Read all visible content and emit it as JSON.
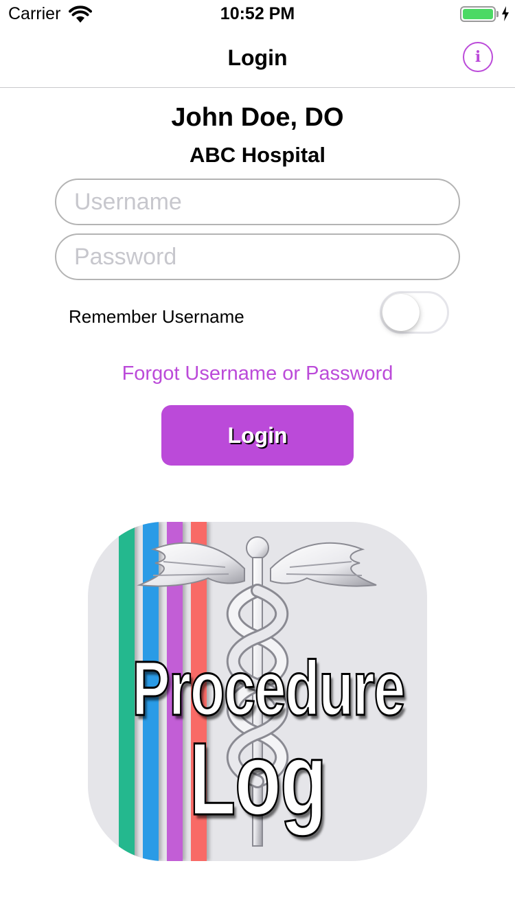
{
  "theme": {
    "accent": "#bb4ad9",
    "toggle_off_border": "#e5e5ea",
    "battery": "#4cd964"
  },
  "status_bar": {
    "carrier": "Carrier",
    "time": "10:52 PM",
    "icons": [
      "wifi-icon",
      "battery-icon",
      "charging-bolt-icon"
    ]
  },
  "nav": {
    "title": "Login",
    "info_glyph": "i",
    "info_icon": "info-icon"
  },
  "profile": {
    "name": "John Doe, DO",
    "hospital": "ABC Hospital"
  },
  "form": {
    "username_placeholder": "Username",
    "username_value": "",
    "password_placeholder": "Password",
    "password_value": "",
    "remember_label": "Remember Username",
    "remember_on": false,
    "forgot_label": "Forgot Username or Password",
    "login_label": "Login"
  },
  "logo": {
    "line1": "Procedure",
    "line2": "Log",
    "stripe_colors": [
      "#24b88e",
      "#2a9be6",
      "#c25ed6",
      "#f86a66"
    ],
    "emblem": "caduceus-icon"
  }
}
